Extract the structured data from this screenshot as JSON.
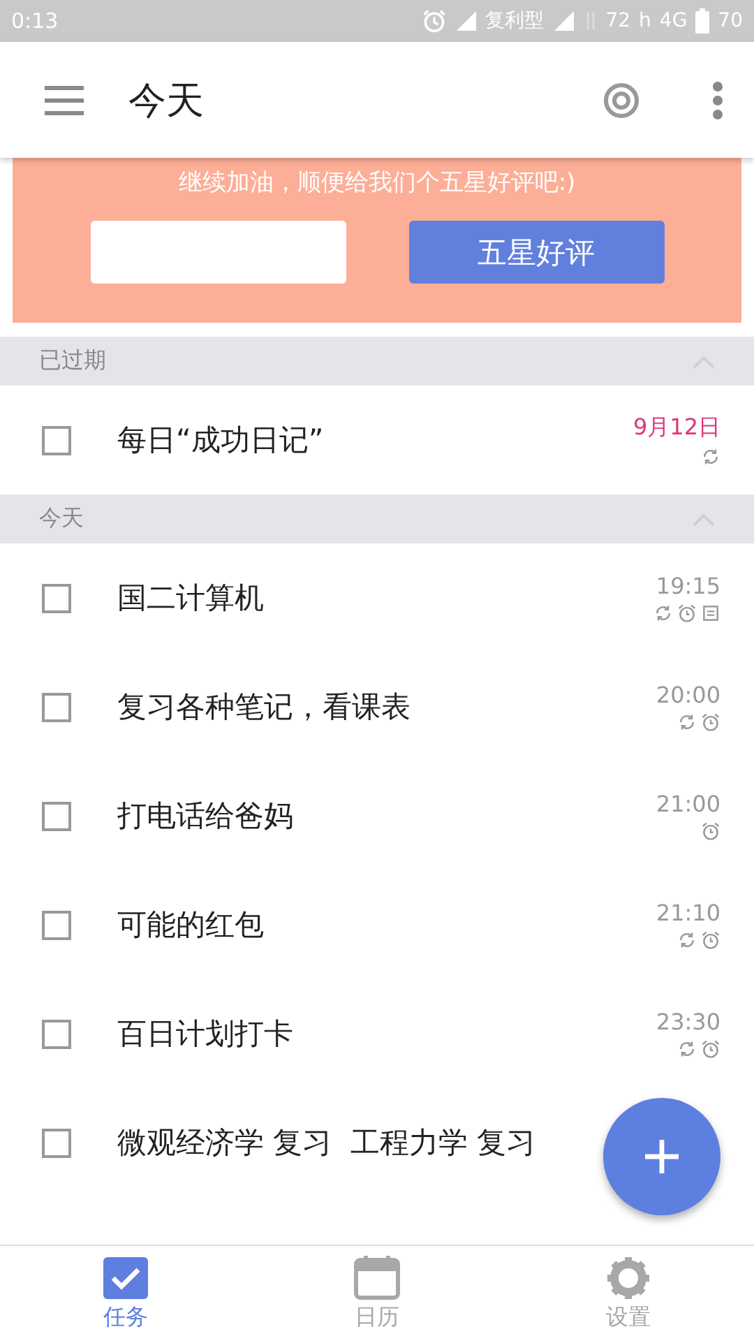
{
  "status_bar": {
    "time": "0:13",
    "carrier": "复利型",
    "speed": "72",
    "network_h": "h",
    "network": "4G",
    "battery": "70"
  },
  "app_bar": {
    "title": "今天"
  },
  "banner": {
    "message": "继续加油，顺便给我们个五星好评吧:)",
    "button": "五星好评"
  },
  "sections": [
    {
      "title": "已过期",
      "kind": "overdue",
      "expanded": true,
      "tasks": [
        {
          "title": "每日“成功日记”",
          "time": "9月12日",
          "checked": false,
          "icons": [
            {
              "kind": "repeat"
            }
          ]
        }
      ]
    },
    {
      "title": "今天",
      "kind": "today",
      "expanded": true,
      "tasks": [
        {
          "title": "国二计算机",
          "time": "19:15",
          "checked": false,
          "icons": [
            {
              "kind": "repeat"
            },
            {
              "kind": "alarm"
            },
            {
              "kind": "note"
            }
          ]
        },
        {
          "title": "复习各种笔记，看课表",
          "time": "20:00",
          "checked": false,
          "icons": [
            {
              "kind": "repeat"
            },
            {
              "kind": "alarm"
            }
          ]
        },
        {
          "title": "打电话给爸妈",
          "time": "21:00",
          "checked": false,
          "icons": [
            {
              "kind": "alarm"
            }
          ]
        },
        {
          "title": "可能的红包",
          "time": "21:10",
          "checked": false,
          "icons": [
            {
              "kind": "repeat"
            },
            {
              "kind": "alarm"
            }
          ]
        },
        {
          "title": "百日计划打卡",
          "time": "23:30",
          "checked": false,
          "icons": [
            {
              "kind": "repeat"
            },
            {
              "kind": "alarm"
            }
          ]
        },
        {
          "title": "微观经济学 复习  工程力学 复习",
          "checked": false
        }
      ]
    }
  ],
  "bottom_nav": [
    {
      "label": "任务",
      "kind": "tasks",
      "selected": true
    },
    {
      "label": "日历",
      "kind": "calendar",
      "selected": false
    },
    {
      "label": "设置",
      "kind": "settings",
      "selected": false
    }
  ]
}
